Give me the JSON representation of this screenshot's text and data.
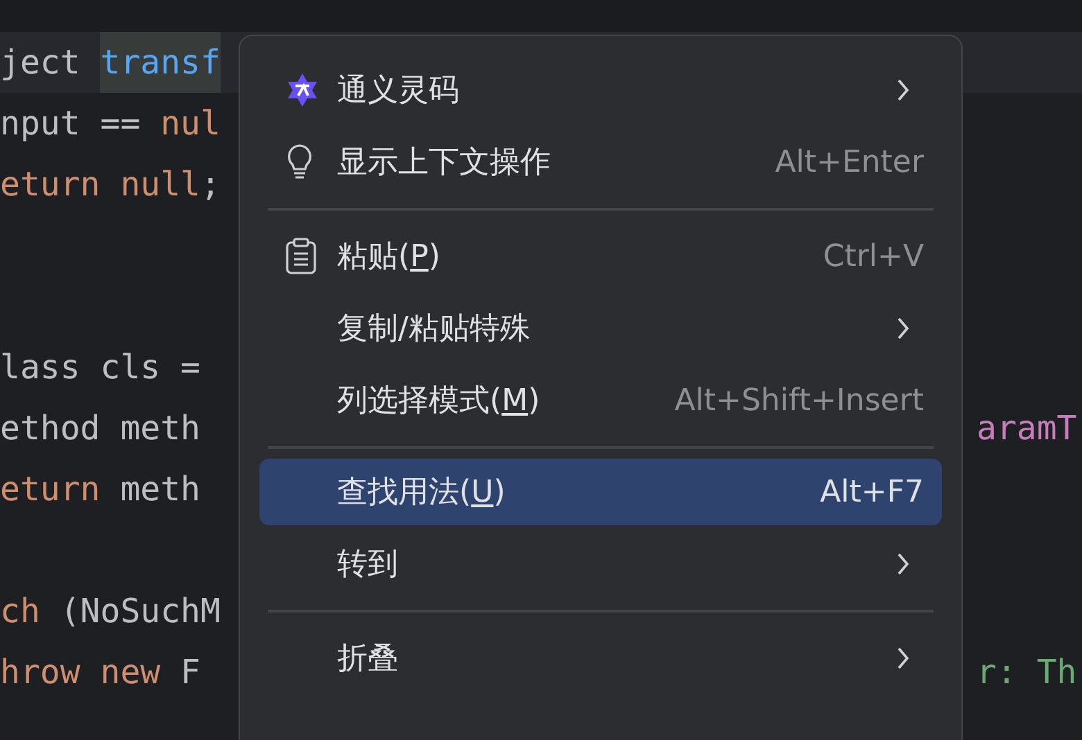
{
  "editor": {
    "lines": [
      {
        "current": true,
        "left": [
          {
            "text": "ject ",
            "kind": "plain",
            "selected": false
          },
          {
            "text": "transf",
            "kind": "method",
            "selected": true
          }
        ]
      },
      {
        "current": false,
        "left": [
          {
            "text": "nput == ",
            "kind": "plain",
            "selected": false
          },
          {
            "text": "nul",
            "kind": "keyword",
            "selected": false
          }
        ]
      },
      {
        "current": false,
        "left": [
          {
            "text": "eturn null",
            "kind": "keyword",
            "selected": false
          },
          {
            "text": ";",
            "kind": "plain",
            "selected": false
          }
        ]
      },
      {
        "current": false
      },
      {
        "current": false
      },
      {
        "current": false,
        "left": [
          {
            "text": "lass cls = ",
            "kind": "plain",
            "selected": false
          }
        ]
      },
      {
        "current": false,
        "left": [
          {
            "text": "ethod meth",
            "kind": "plain",
            "selected": false
          }
        ],
        "right": [
          {
            "text": "aramT",
            "kind": "field",
            "selected": false
          }
        ]
      },
      {
        "current": false,
        "left": [
          {
            "text": "eturn",
            "kind": "keyword",
            "selected": false
          },
          {
            "text": " meth",
            "kind": "plain",
            "selected": false
          }
        ]
      },
      {
        "current": false
      },
      {
        "current": false,
        "left": [
          {
            "text": "ch",
            "kind": "keyword",
            "selected": false
          },
          {
            "text": " (NoSuchM",
            "kind": "plain",
            "selected": false
          }
        ]
      },
      {
        "current": false,
        "left": [
          {
            "text": "hrow new",
            "kind": "keyword",
            "selected": false
          },
          {
            "text": " F",
            "kind": "plain",
            "selected": false
          }
        ],
        "right": [
          {
            "text": "r: Th",
            "kind": "string",
            "selected": false
          }
        ]
      }
    ]
  },
  "context_menu": {
    "items": [
      {
        "kind": "item",
        "label": "通义灵码",
        "submenu": true,
        "selected": false
      },
      {
        "kind": "item",
        "label": "显示上下文操作",
        "shortcut": "Alt+Enter",
        "submenu": false,
        "selected": false
      },
      {
        "kind": "separator"
      },
      {
        "kind": "item",
        "label": "粘贴(",
        "mnemonic": "P",
        "label_end": ")",
        "shortcut": "Ctrl+V",
        "submenu": false,
        "selected": false
      },
      {
        "kind": "item",
        "label": "复制/粘贴特殊",
        "submenu": true,
        "selected": false
      },
      {
        "kind": "item",
        "label": "列选择模式(",
        "mnemonic": "M",
        "label_end": ")",
        "shortcut": "Alt+Shift+Insert",
        "submenu": false,
        "selected": false
      },
      {
        "kind": "separator"
      },
      {
        "kind": "item",
        "label": "查找用法(",
        "mnemonic": "U",
        "label_end": ")",
        "shortcut": "Alt+F7",
        "submenu": false,
        "selected": true
      },
      {
        "kind": "item",
        "label": "转到",
        "submenu": true,
        "selected": false
      },
      {
        "kind": "separator"
      },
      {
        "kind": "item",
        "label": "折叠",
        "submenu": true,
        "selected": false
      }
    ]
  }
}
